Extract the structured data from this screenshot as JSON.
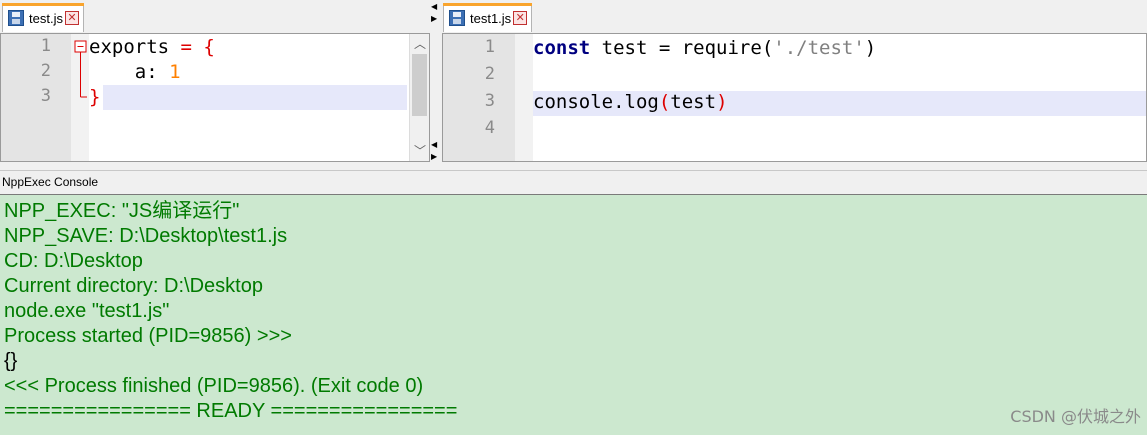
{
  "left_tab": {
    "label": "test.js",
    "close_glyph": "✕",
    "icon": "save-icon"
  },
  "right_tab": {
    "label": "test1.js",
    "close_glyph": "✕",
    "icon": "save-icon"
  },
  "left_editor": {
    "line_numbers": [
      "1",
      "2",
      "3"
    ],
    "lines": [
      {
        "tokens": [
          {
            "t": "exports ",
            "c": "#000000"
          },
          {
            "t": "=",
            "c": "#dd0000"
          },
          {
            "t": " {",
            "c": "#dd0000"
          }
        ]
      },
      {
        "tokens": [
          {
            "t": "    a",
            "c": "#000000"
          },
          {
            "t": ":",
            "c": "#000000"
          },
          {
            "t": " 1",
            "c": "#ff8000"
          }
        ]
      },
      {
        "tokens": [
          {
            "t": "}",
            "c": "#dd0000"
          }
        ]
      }
    ],
    "current_line": 3
  },
  "right_editor": {
    "line_numbers": [
      "1",
      "2",
      "3",
      "4"
    ],
    "lines": [
      {
        "tokens": [
          {
            "t": "const",
            "c": "#000080",
            "b": true
          },
          {
            "t": " test ",
            "c": "#000000"
          },
          {
            "t": "=",
            "c": "#000000"
          },
          {
            "t": " require",
            "c": "#000000"
          },
          {
            "t": "(",
            "c": "#000000"
          },
          {
            "t": "'./test'",
            "c": "#808080"
          },
          {
            "t": ")",
            "c": "#000000"
          }
        ]
      },
      {
        "tokens": []
      },
      {
        "tokens": [
          {
            "t": "console.log",
            "c": "#000000"
          },
          {
            "t": "(",
            "c": "#dd0000"
          },
          {
            "t": "test",
            "c": "#000000"
          },
          {
            "t": ")",
            "c": "#dd0000"
          }
        ]
      },
      {
        "tokens": []
      }
    ],
    "current_line": 3
  },
  "console": {
    "title": "NppExec Console",
    "lines": [
      {
        "text": "NPP_EXEC: \"JS编译运行\"",
        "color": "#007a00"
      },
      {
        "text": "NPP_SAVE: D:\\Desktop\\test1.js",
        "color": "#007a00"
      },
      {
        "text": "CD: D:\\Desktop",
        "color": "#007a00"
      },
      {
        "text": "Current directory: D:\\Desktop",
        "color": "#007a00"
      },
      {
        "text": "node.exe \"test1.js\"",
        "color": "#007a00"
      },
      {
        "text": "Process started (PID=9856) >>>",
        "color": "#007a00"
      },
      {
        "text": "{}",
        "color": "#000000"
      },
      {
        "text": "<<< Process finished (PID=9856). (Exit code 0)",
        "color": "#007a00"
      },
      {
        "text": "================ READY ================",
        "color": "#007a00"
      }
    ]
  },
  "watermark": "CSDN @伏城之外",
  "colors": {
    "tab_accent": "#f9a42c",
    "console_bg": "#cce8cf",
    "current_line": "#e6e8fa"
  }
}
